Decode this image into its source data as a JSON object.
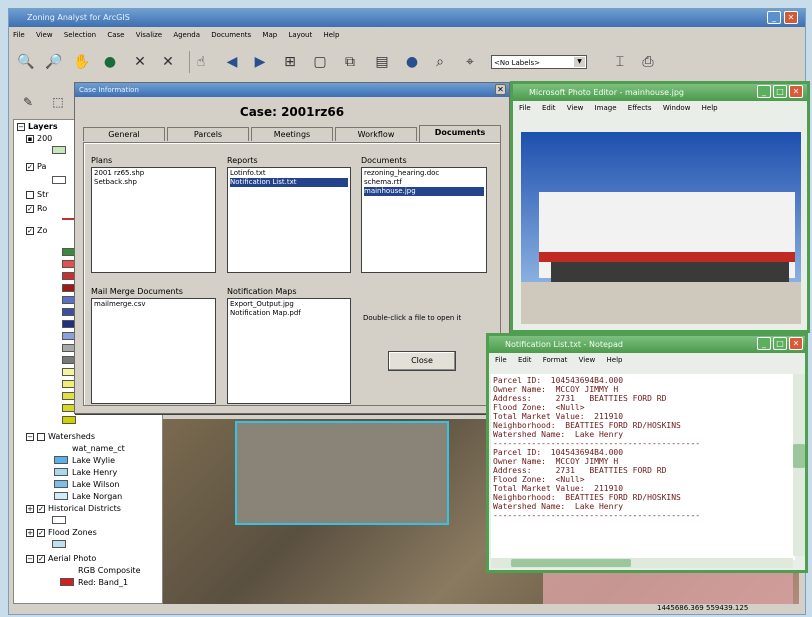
{
  "app": {
    "title": "Zoning Analyst for ArcGIS",
    "menu": [
      "File",
      "View",
      "Selection",
      "Case",
      "Visalize",
      "Agenda",
      "Documents",
      "Map",
      "Layout",
      "Help"
    ],
    "label_combo": "<No Labels>"
  },
  "toc": {
    "root": "Layers",
    "items": [
      "Watersheds",
      "Historical Districts",
      "Flood Zones",
      "Aerial Photo"
    ],
    "watershed_field": "wat_name_ct",
    "watershed_values": [
      "Lake Wylie",
      "Lake Henry",
      "Lake Wilson",
      "Lake Norgan"
    ],
    "aerial_sub": [
      "RGB Composite",
      "Red: Band_1"
    ],
    "partial": [
      "200",
      "Pa",
      "Str",
      "Ro",
      "Zo"
    ]
  },
  "case_dialog": {
    "window_title": "Case Information",
    "case_title": "Case: 2001rz66",
    "tabs": [
      "General",
      "Parcels",
      "Meetings",
      "Workflow",
      "Documents"
    ],
    "plans_label": "Plans",
    "plans": [
      "2001 rz65.shp",
      "Setback.shp"
    ],
    "reports_label": "Reports",
    "reports": [
      "Lotinfo.txt",
      "Notification List.txt"
    ],
    "documents_label": "Documents",
    "documents": [
      "rezoning_hearing.doc",
      "schema.rtf",
      "mainhouse.jpg"
    ],
    "mailmerge_label": "Mail Merge Documents",
    "mailmerge": [
      "mailmerge.csv"
    ],
    "notif_maps_label": "Notification Maps",
    "notif_maps": [
      "Export_Output.jpg",
      "Notification Map.pdf"
    ],
    "hint": "Double-click a file to open it",
    "close_label": "Close"
  },
  "photo_editor": {
    "title": "Microsoft Photo Editor - mainhouse.jpg",
    "menu": [
      "File",
      "Edit",
      "View",
      "Image",
      "Effects",
      "Window",
      "Help"
    ]
  },
  "notepad": {
    "title": "Notification List.txt - Notepad",
    "menu": [
      "File",
      "Edit",
      "Format",
      "View",
      "Help"
    ],
    "lines": [
      "Parcel ID:  104543694B4.000",
      "Owner Name:  MCCOY JIMMY H",
      "Address:     2731   BEATTIES FORD RD",
      "Flood Zone:  <Null>",
      "Total Market Value:  211910",
      "Neighborhood:  BEATTIES FORD RD/HOSKINS",
      "Watershed Name:  Lake Henry",
      "-------------------------------------------",
      "Parcel ID:  104543694B4.000",
      "Owner Name:  MCCOY JIMMY H",
      "Address:     2731   BEATTIES FORD RD",
      "Flood Zone:  <Null>",
      "Total Market Value:  211910",
      "Neighborhood:  BEATTIES FORD RD/HOSKINS",
      "Watershed Name:  Lake Henry",
      "-------------------------------------------"
    ]
  },
  "status": {
    "coords": "1445686.369  559439.125"
  },
  "colors": {
    "accent": "#3e6fb1",
    "xp_green": "#4b9a4c",
    "selection": "#23448c",
    "notepad_text": "#6b1818"
  },
  "icons": [
    "zoom-in-icon",
    "zoom-out-icon",
    "pan-icon",
    "globe-icon",
    "full-extent-icon",
    "identify-icon",
    "back-icon",
    "forward-icon",
    "select-icon",
    "print-icon"
  ]
}
